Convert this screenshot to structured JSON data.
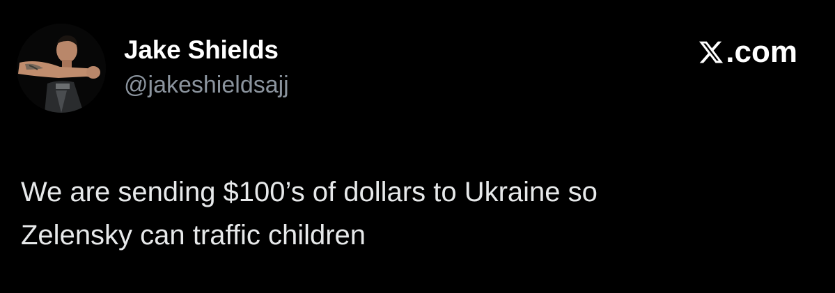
{
  "tweet": {
    "author": {
      "display_name": "Jake Shields",
      "handle": "@jakeshieldsajj",
      "avatar_icon": "profile-photo"
    },
    "brand": {
      "icon": "x-logo-icon",
      "label": ".com"
    },
    "text_lines": [
      "We are sending $100’s of dollars to Ukraine so",
      "Zelensky can traffic children"
    ]
  },
  "colors": {
    "background": "#000000",
    "name": "#ffffff",
    "handle": "#8b949e",
    "body_text": "#e7e9ea"
  }
}
